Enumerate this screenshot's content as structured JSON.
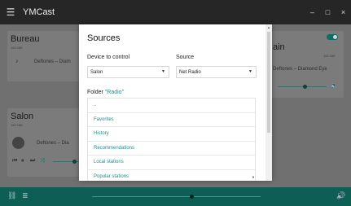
{
  "app": {
    "title": "YMCast"
  },
  "window_controls": {
    "minimize": "–",
    "maximize": "□",
    "close": "×"
  },
  "background": {
    "card_bureau": {
      "name": "Bureau",
      "sub": "192.168",
      "track": "Deftones – Diam"
    },
    "card_right": {
      "name": "ain",
      "sub": "192.168",
      "track": "Deftones – Diamond Eye",
      "toggle_on": true
    },
    "card_salon": {
      "name": "Salon",
      "sub": "192.168",
      "track": "Deftones – Dia"
    }
  },
  "modal": {
    "title": "Sources",
    "device_label": "Device to control",
    "device_value": "Salon",
    "source_label": "Source",
    "source_value": "Net Radio",
    "folder_prefix": "Folder",
    "folder_name": "\"Radio\"",
    "items": [
      "..",
      "Favorites",
      "History",
      "Recommendations",
      "Local stations",
      "Popular stations"
    ]
  },
  "bottom_bar": {
    "volume_level": 0.59
  },
  "colors": {
    "accent": "#1c8f84",
    "bottom_bar": "#0d5e54",
    "title_bar": "#262626"
  },
  "icons": [
    "hamburger-menu-icon",
    "minimize-icon",
    "maximize-icon",
    "close-icon",
    "link-icon",
    "queue-icon",
    "volume-icon",
    "chevron-down-icon"
  ]
}
